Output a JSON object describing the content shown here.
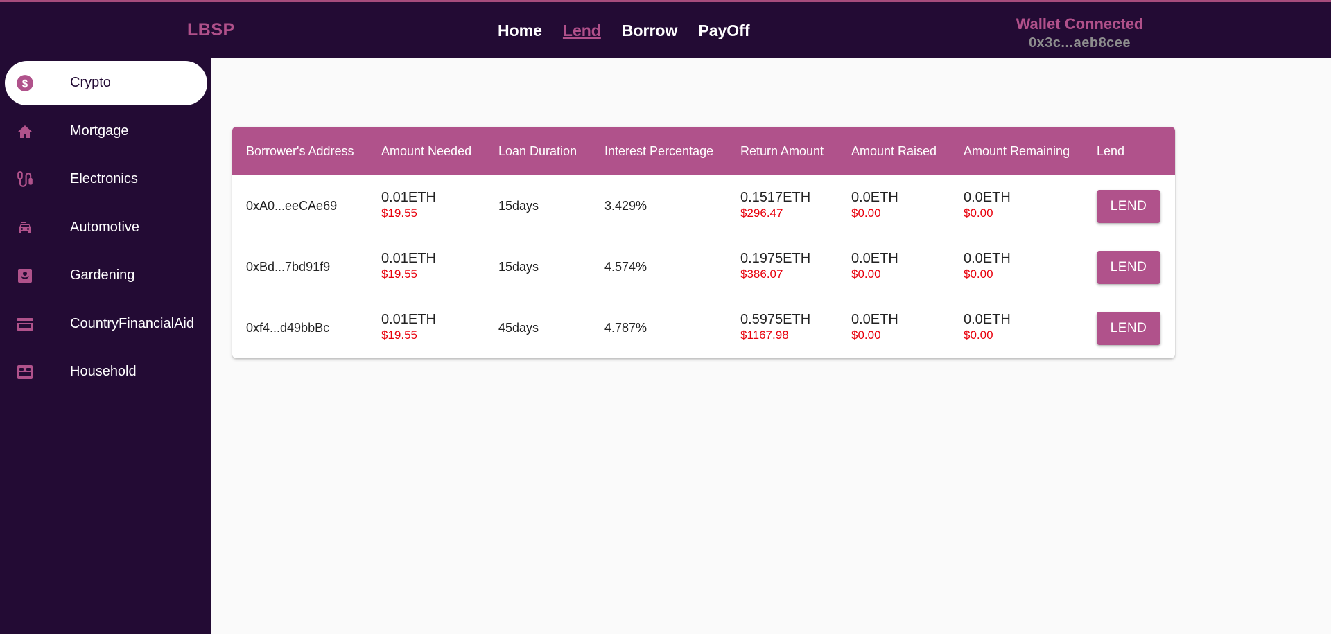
{
  "header": {
    "brand": "LBSP",
    "nav": [
      "Home",
      "Lend",
      "Borrow",
      "PayOff"
    ],
    "active_nav": "Lend",
    "wallet_status": "Wallet Connected",
    "wallet_address": "0x3c...aeb8cee"
  },
  "sidebar": {
    "items": [
      {
        "label": "Crypto",
        "icon": "dollar-circle-icon",
        "active": true
      },
      {
        "label": "Mortgage",
        "icon": "home-icon"
      },
      {
        "label": "Electronics",
        "icon": "electronics-icon"
      },
      {
        "label": "Automotive",
        "icon": "car-icon"
      },
      {
        "label": "Gardening",
        "icon": "garden-icon"
      },
      {
        "label": "CountryFinancialAid",
        "icon": "credit-card-icon"
      },
      {
        "label": "Household",
        "icon": "bed-icon"
      }
    ]
  },
  "table": {
    "columns": [
      "Borrower's Address",
      "Amount Needed",
      "Loan Duration",
      "Interest Percentage",
      "Return Amount",
      "Amount Raised",
      "Amount Remaining",
      "Lend"
    ],
    "rows": [
      {
        "address": "0xA0...eeCAe69",
        "needed_eth": "0.01ETH",
        "needed_usd": "$19.55",
        "duration": "15days",
        "interest": "3.429%",
        "return_eth": "0.1517ETH",
        "return_usd": "$296.47",
        "raised_eth": "0.0ETH",
        "raised_usd": "$0.00",
        "remaining_eth": "0.0ETH",
        "remaining_usd": "$0.00",
        "action": "LEND"
      },
      {
        "address": "0xBd...7bd91f9",
        "needed_eth": "0.01ETH",
        "needed_usd": "$19.55",
        "duration": "15days",
        "interest": "4.574%",
        "return_eth": "0.1975ETH",
        "return_usd": "$386.07",
        "raised_eth": "0.0ETH",
        "raised_usd": "$0.00",
        "remaining_eth": "0.0ETH",
        "remaining_usd": "$0.00",
        "action": "LEND"
      },
      {
        "address": "0xf4...d49bbBc",
        "needed_eth": "0.01ETH",
        "needed_usd": "$19.55",
        "duration": "45days",
        "interest": "4.787%",
        "return_eth": "0.5975ETH",
        "return_usd": "$1167.98",
        "raised_eth": "0.0ETH",
        "raised_usd": "$0.00",
        "remaining_eth": "0.0ETH",
        "remaining_usd": "$0.00",
        "action": "LEND"
      }
    ]
  },
  "colors": {
    "background_dark": "#230b34",
    "accent": "#b0528b",
    "usd_red": "#e8000c",
    "wallet_grey": "#8d8d8d"
  }
}
